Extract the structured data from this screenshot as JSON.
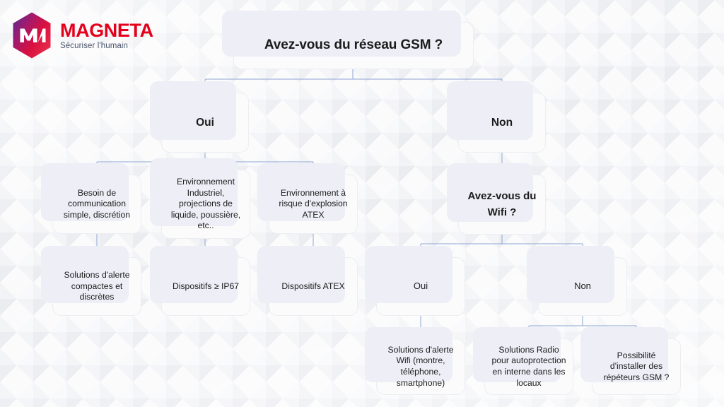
{
  "brand": {
    "name": "MAGNETA",
    "tagline": "Sécuriser l'humain",
    "logo_icon": "magneta-hexagon-logo",
    "red": "#e4011b",
    "tagline_color": "#4a5568"
  },
  "theme": {
    "background": "#fafafb",
    "card_background": "#fbfbfc",
    "card_shadow": "#edeef6",
    "connector_line": "#8ea6d4",
    "text": "#1b1b1b"
  },
  "chart_data": {
    "type": "diagram",
    "title": "Avez-vous du réseau GSM ?",
    "nodes": [
      {
        "id": "root",
        "label": "Avez-vous du réseau GSM ?",
        "level": 1,
        "kind": "question"
      },
      {
        "id": "oui1",
        "label": "Oui",
        "level": 2,
        "kind": "answer"
      },
      {
        "id": "non1",
        "label": "Non",
        "level": 2,
        "kind": "answer"
      },
      {
        "id": "c1",
        "label": "Besoin de communication simple, discrétion",
        "level": 3,
        "kind": "condition"
      },
      {
        "id": "c2",
        "label": "Environnement Industriel, projections de liquide, poussière, etc..",
        "level": 3,
        "kind": "condition"
      },
      {
        "id": "c3",
        "label": "Environnement à risque d'explosion ATEX",
        "level": 3,
        "kind": "condition"
      },
      {
        "id": "wifi",
        "label": "Avez-vous du Wifi ?",
        "level": 3,
        "kind": "question"
      },
      {
        "id": "s1",
        "label": "Solutions d'alerte compactes et discrètes",
        "level": 4,
        "kind": "solution"
      },
      {
        "id": "s2",
        "label": "Dispositifs ≥ IP67",
        "level": 4,
        "kind": "solution"
      },
      {
        "id": "s3",
        "label": "Dispositifs ATEX",
        "level": 4,
        "kind": "solution"
      },
      {
        "id": "oui2",
        "label": "Oui",
        "level": 4,
        "kind": "answer"
      },
      {
        "id": "non2",
        "label": "Non",
        "level": 4,
        "kind": "answer"
      },
      {
        "id": "s4",
        "label": "Solutions d'alerte Wifi (montre, téléphone, smartphone)",
        "level": 5,
        "kind": "solution"
      },
      {
        "id": "s5",
        "label": "Solutions Radio pour autoprotection en interne dans les locaux",
        "level": 5,
        "kind": "solution"
      },
      {
        "id": "s6",
        "label": "Possibilité d'installer des répéteurs GSM ?",
        "level": 5,
        "kind": "solution"
      }
    ],
    "edges": [
      {
        "from": "root",
        "to": "oui1"
      },
      {
        "from": "root",
        "to": "non1"
      },
      {
        "from": "oui1",
        "to": "c1"
      },
      {
        "from": "oui1",
        "to": "c2"
      },
      {
        "from": "oui1",
        "to": "c3"
      },
      {
        "from": "non1",
        "to": "wifi"
      },
      {
        "from": "c1",
        "to": "s1"
      },
      {
        "from": "c2",
        "to": "s2"
      },
      {
        "from": "c3",
        "to": "s3"
      },
      {
        "from": "wifi",
        "to": "oui2"
      },
      {
        "from": "wifi",
        "to": "non2"
      },
      {
        "from": "oui2",
        "to": "s4"
      },
      {
        "from": "non2",
        "to": "s5"
      },
      {
        "from": "non2",
        "to": "s6"
      }
    ]
  }
}
